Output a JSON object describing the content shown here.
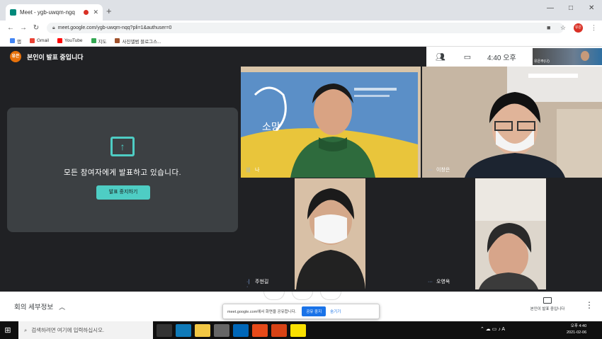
{
  "browser": {
    "tab_title": "Meet - ygb-uwqm-ngq",
    "new_tab": "+",
    "window_controls": {
      "minimize": "—",
      "restore": "□",
      "close": "✕"
    },
    "url": "meet.google.com/ygb-uwqm-nqq?pli=1&authuser=0",
    "profile_initials": "유은"
  },
  "bookmarks": [
    {
      "label": "앱",
      "color": "#ea4335"
    },
    {
      "label": "Gmail",
      "color": "#ea4335"
    },
    {
      "label": "YouTube",
      "color": "#ff0000"
    },
    {
      "label": "지도",
      "color": "#34a853"
    },
    {
      "label": "사진앨범 블로그스...",
      "color": "#a0522d"
    }
  ],
  "meet": {
    "presenting_avatar": "유은",
    "presenting_label": "본인이 발표 중입니다",
    "time": "4:40 오후",
    "self_thumb_name": "유은주(나)",
    "present_message": "모든 참여자에게 발표하고 있습니다.",
    "stop_button": "발표 중지하기",
    "tiles": [
      {
        "name": "나"
      },
      {
        "name": "이창은"
      },
      {
        "name": "주현길"
      },
      {
        "name": "오영옥"
      }
    ],
    "meeting_details": "회의 세부정보",
    "share_notice": "meet.google.com에서 화면을 공유합니다.",
    "share_stop": "공유 중지",
    "share_hide": "숨기기",
    "present_now": "본인이 발표 중입니다"
  },
  "taskbar": {
    "search_placeholder": "검색하려면 여기에 입력하십시오.",
    "clock_time": "오후 4:40",
    "clock_date": "2021-02-06",
    "ime": "A"
  },
  "colors": {
    "accent_teal": "#4ecdc4",
    "meet_dark": "#202124",
    "card": "#3c4043"
  }
}
